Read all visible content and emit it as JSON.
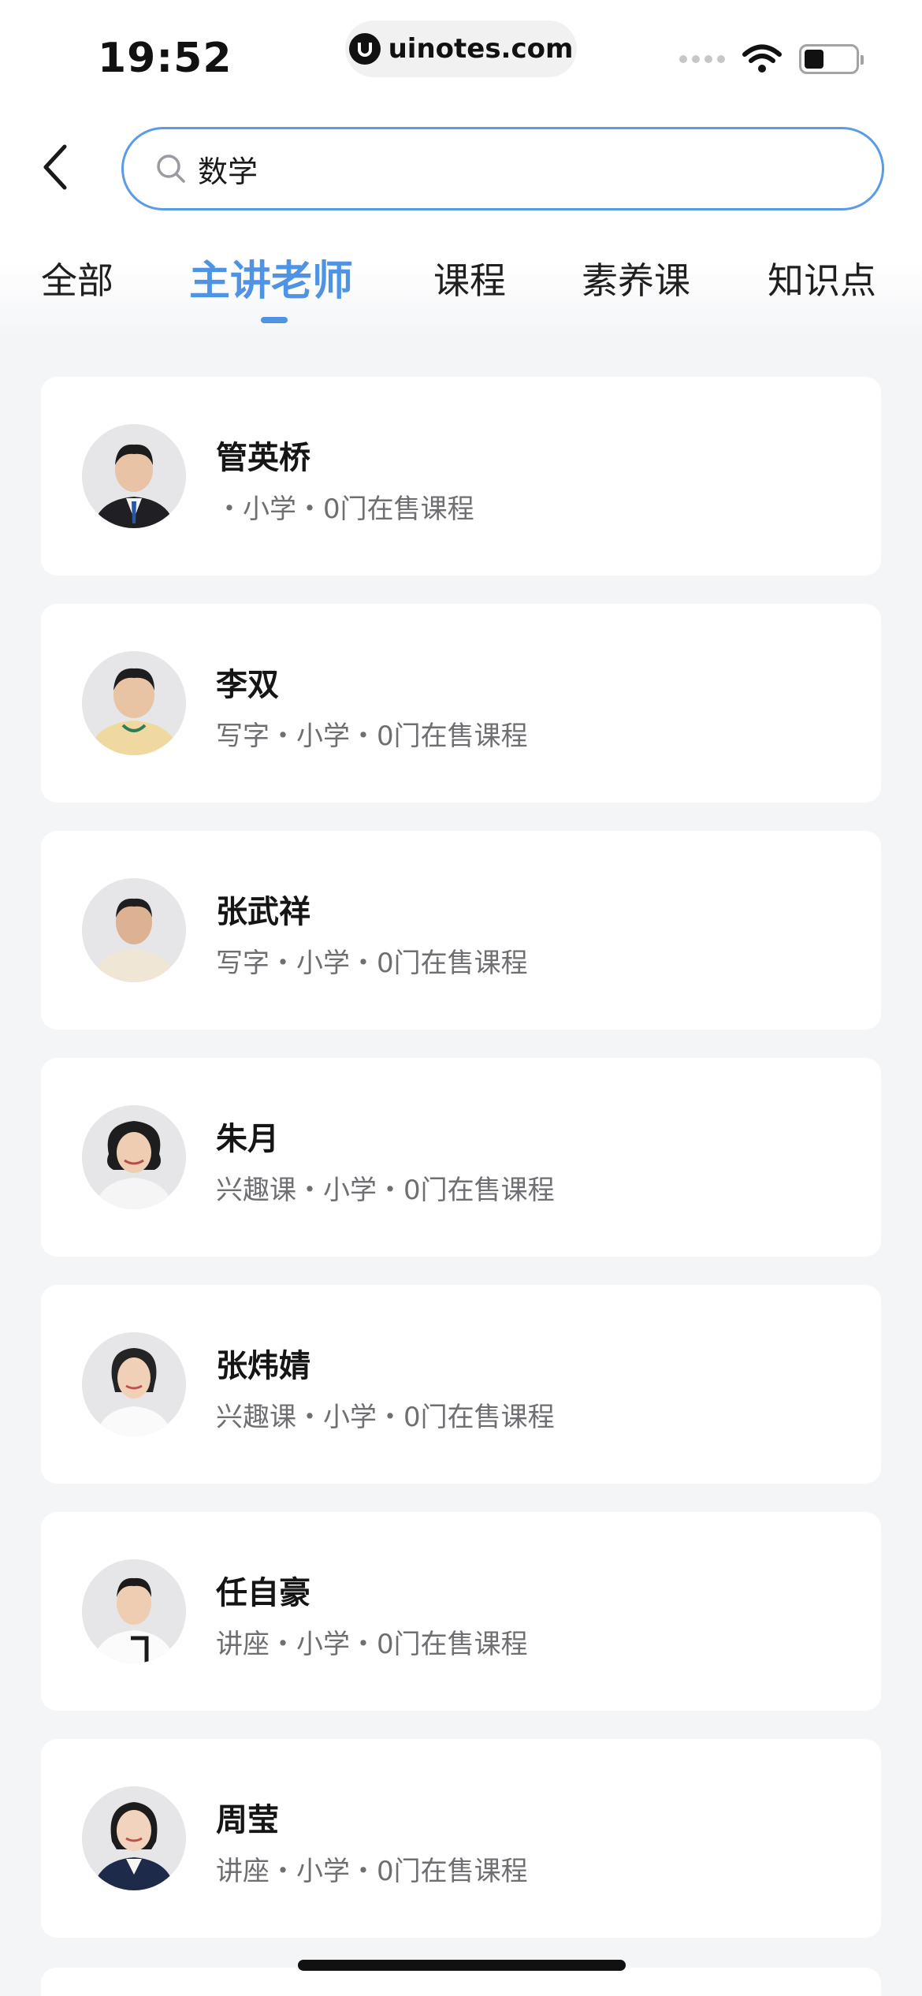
{
  "status_bar": {
    "time": "19:52",
    "url": "uinotes.com"
  },
  "search": {
    "query": "数学"
  },
  "tabs": [
    {
      "label": "全部"
    },
    {
      "label": "主讲老师"
    },
    {
      "label": "课程"
    },
    {
      "label": "素养课"
    },
    {
      "label": "知识点"
    }
  ],
  "active_tab": "主讲老师",
  "accent_color": "#4f93e4",
  "teachers": [
    {
      "name": "管英桥",
      "meta": "・小学・0门在售课程"
    },
    {
      "name": "李双",
      "meta": "写字・小学・0门在售课程"
    },
    {
      "name": "张武祥",
      "meta": "写字・小学・0门在售课程"
    },
    {
      "name": "朱月",
      "meta": "兴趣课・小学・0门在售课程"
    },
    {
      "name": "张炜婧",
      "meta": "兴趣课・小学・0门在售课程"
    },
    {
      "name": "任自豪",
      "meta": "讲座・小学・0门在售课程"
    },
    {
      "name": "周莹",
      "meta": "讲座・小学・0门在售课程"
    }
  ]
}
